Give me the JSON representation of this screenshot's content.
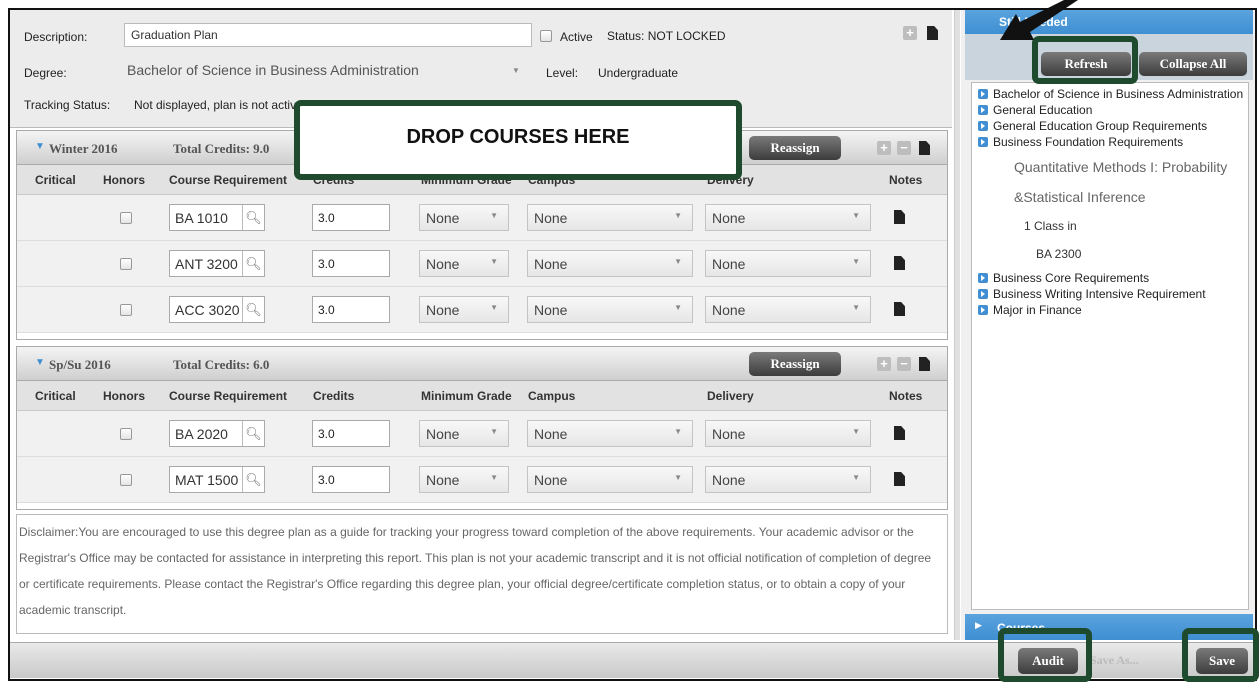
{
  "header": {
    "description_label": "Description:",
    "description_value": "Graduation Plan",
    "active_label": "Active",
    "status_text": "Status: NOT LOCKED",
    "degree_label": "Degree:",
    "degree_value": "Bachelor of Science in Business Administration",
    "level_label": "Level:",
    "level_value": "Undergraduate",
    "tracking_label": "Tracking Status:",
    "tracking_value": "Not displayed, plan is not active"
  },
  "drop_zone": "DROP COURSES HERE",
  "columns": {
    "critical": "Critical",
    "honors": "Honors",
    "course": "Course Requirement",
    "credits": "Credits",
    "min_grade": "Minimum Grade",
    "campus": "Campus",
    "delivery": "Delivery",
    "notes": "Notes"
  },
  "terms": [
    {
      "name": "Winter 2016",
      "total_credits": "Total Credits: 9.0",
      "reassign": "Reassign",
      "rows": [
        {
          "course": "BA 1010",
          "credits": "3.0",
          "min_grade": "None",
          "campus": "None",
          "delivery": "None"
        },
        {
          "course": "ANT 3200",
          "credits": "3.0",
          "min_grade": "None",
          "campus": "None",
          "delivery": "None"
        },
        {
          "course": "ACC 3020",
          "credits": "3.0",
          "min_grade": "None",
          "campus": "None",
          "delivery": "None"
        }
      ]
    },
    {
      "name": "Sp/Su 2016",
      "total_credits": "Total Credits: 6.0",
      "reassign": "Reassign",
      "rows": [
        {
          "course": "BA 2020",
          "credits": "3.0",
          "min_grade": "None",
          "campus": "None",
          "delivery": "None"
        },
        {
          "course": "MAT 1500",
          "credits": "3.0",
          "min_grade": "None",
          "campus": "None",
          "delivery": "None"
        }
      ]
    }
  ],
  "disclaimer": "Disclaimer:You are encouraged to use this degree plan as a guide for tracking your progress toward completion of the above requirements. Your academic advisor or the Registrar's Office may be contacted for assistance in interpreting this report. This plan is not your academic transcript and it is not official notification of completion of degree or certificate requirements. Please contact the Registrar's Office regarding this degree plan, your official degree/certificate completion status, or to obtain a copy of your academic transcript.",
  "right_panel": {
    "title": "Still Needed",
    "refresh": "Refresh",
    "collapse_all": "Collapse All",
    "tree": [
      "Bachelor of Science in Business Administration",
      "General Education",
      "General Education Group Requirements",
      "Business Foundation Requirements"
    ],
    "detail": [
      "Quantitative Methods I: Probability",
      "&Statistical Inference",
      "1 Class in",
      "BA 2300"
    ],
    "tree2": [
      "Business Core Requirements",
      "Business Writing Intensive Requirement",
      "Major in Finance"
    ],
    "courses_label": "Courses"
  },
  "footer": {
    "audit": "Audit",
    "save_as": "Save As...",
    "save": "Save"
  },
  "colors": {
    "accent_blue": "#3f8fd2",
    "highlight_green": "#1e4a2d"
  }
}
